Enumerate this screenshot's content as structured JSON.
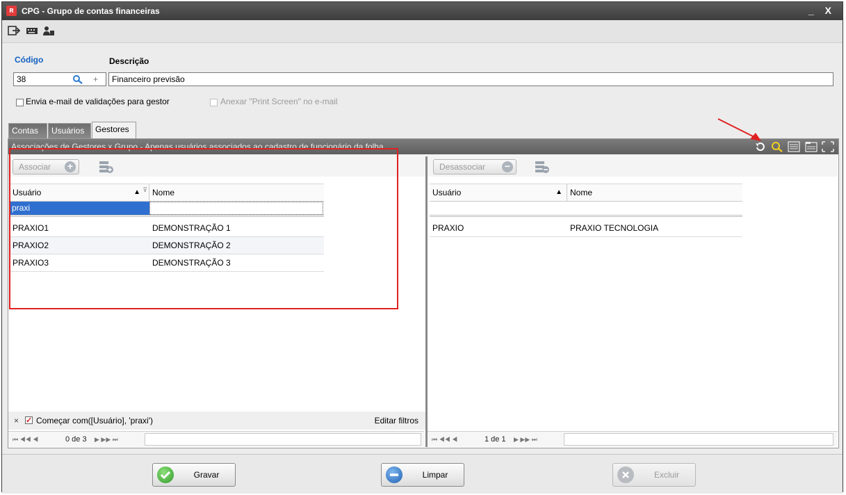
{
  "window": {
    "title": "CPG - Grupo de contas financeiras",
    "controls": "_ X"
  },
  "form": {
    "codigo_label": "Código",
    "descricao_label": "Descrição",
    "codigo_value": "38",
    "descricao_value": "Financeiro previsão",
    "plus": "+",
    "check_email": "Envia e-mail de validações para gestor",
    "check_print": "Anexar \"Print Screen\" no e-mail"
  },
  "tabs": [
    {
      "label": "Contas"
    },
    {
      "label": "Usuários"
    },
    {
      "label": "Gestores"
    }
  ],
  "grid_header": "Associações de Gestores x Grupo - Apenas usuários associados ao cadastro de funcionário da folha",
  "left": {
    "button": "Associar",
    "columns": [
      "Usuário",
      "Nome"
    ],
    "filter_value": "praxi",
    "rows": [
      {
        "usuario": "PRAXIO1",
        "nome": "DEMONSTRAÇÃO 1"
      },
      {
        "usuario": "PRAXIO2",
        "nome": "DEMONSTRAÇÃO 2"
      },
      {
        "usuario": "PRAXIO3",
        "nome": "DEMONSTRAÇÃO 3"
      }
    ],
    "filter_text": "Começar com([Usuário], 'praxi')",
    "edit_filters": "Editar filtros",
    "close_filter": "×",
    "pager_left": "⏮  ◀◀  ◀",
    "pager": "0 de 3",
    "pager_right": "▶  ▶▶  ⏭"
  },
  "right": {
    "button": "Desassociar",
    "columns": [
      "Usuário",
      "Nome"
    ],
    "rows": [
      {
        "usuario": "PRAXIO",
        "nome": "PRAXIO TECNOLOGIA"
      }
    ],
    "pager_left": "⏮  ◀◀  ◀",
    "pager": "1 de 1",
    "pager_right": "▶  ▶▶  ⏭"
  },
  "bottom": {
    "save": "Gravar",
    "clear": "Limpar",
    "delete": "Excluir"
  },
  "colors": {
    "accent_blue": "#1060c0",
    "selected_row": "#2f6fd0",
    "highlight_red": "#e02020"
  }
}
